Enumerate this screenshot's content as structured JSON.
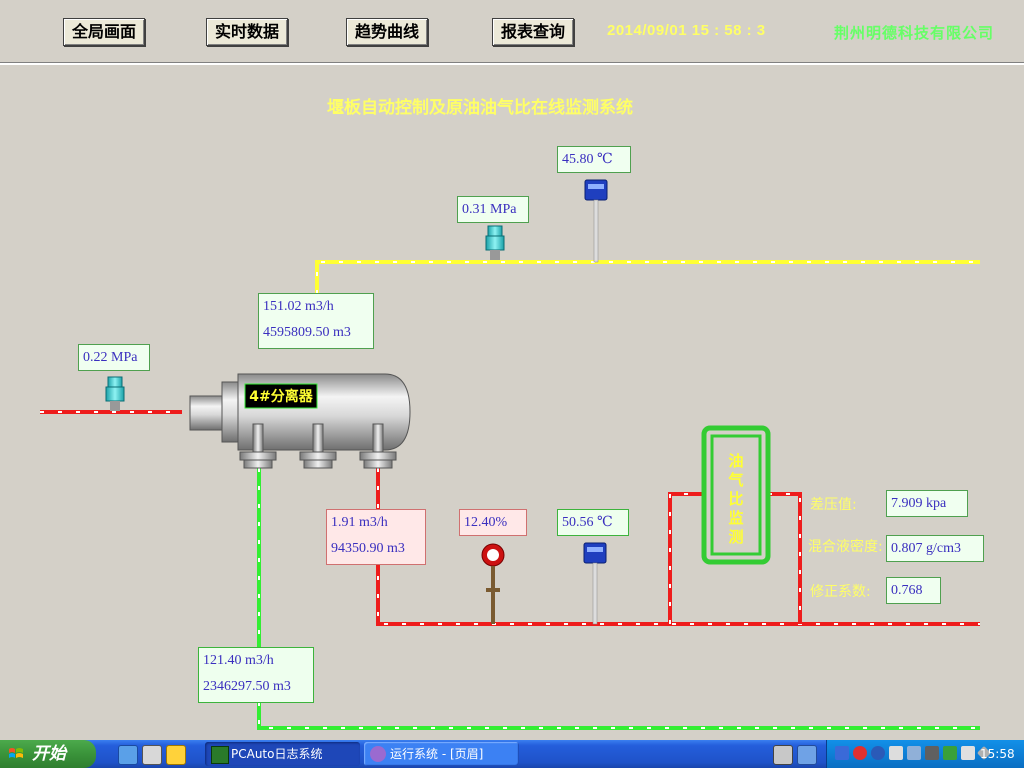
{
  "nav": {
    "overview": "全局画面",
    "realtime": "实时数据",
    "trend": "趋势曲线",
    "report": "报表查询"
  },
  "datetime": "2014/09/01   15 : 58 : 3",
  "company": "荆州明德科技有限公司",
  "title": "堰板自动控制及原油油气比在线监测系统",
  "separator_label": "4#分离器",
  "monitor_label": "油\n气\n比\n监\n测",
  "readings": {
    "gas_temp": "45.80 ℃",
    "gas_pressure": "0.31 MPa",
    "gas_flow_rate": "151.02 m3/h",
    "gas_flow_total": "4595809.50 m3",
    "inlet_pressure": "0.22 MPa",
    "oil_flow_rate": "1.91 m3/h",
    "oil_flow_total": "94350.90 m3",
    "water_cut": "12.40%",
    "oil_temp": "50.56 ℃",
    "water_flow_rate": "121.40 m3/h",
    "water_flow_total": "2346297.50 m3"
  },
  "ratio_panel": {
    "dp_label": "差压值:",
    "dp_value": "7.909 kpa",
    "density_label": "混合液密度:",
    "density_value": "0.807 g/cm3",
    "coef_label": "修正系数:",
    "coef_value": "0.768"
  },
  "colors": {
    "gas_pipe": "#ffff33",
    "oil_pipe": "#ee1c1c",
    "water_pipe": "#33ee33",
    "label_yellow": "#ffff66",
    "value_blue": "#3a2fbf"
  },
  "taskbar": {
    "start": "开始",
    "tasks": [
      {
        "label": "PCAuto日志系统",
        "icon": "log-icon",
        "active": true
      },
      {
        "label": "运行系统 - [页眉]",
        "icon": "runtime-icon",
        "active": false
      }
    ],
    "clock": "15:58"
  }
}
